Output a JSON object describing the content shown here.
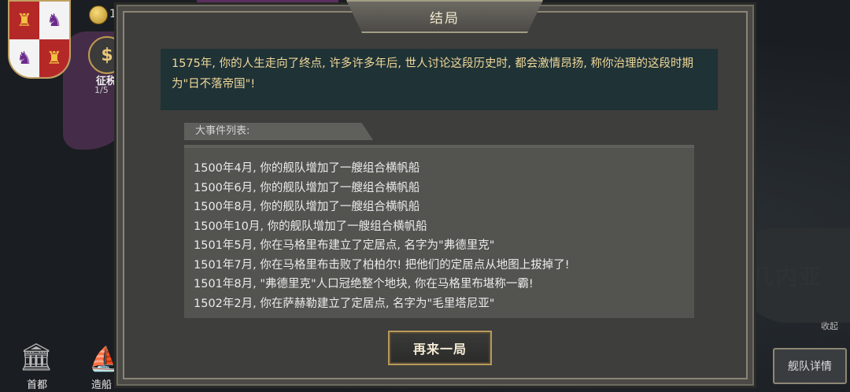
{
  "hud": {
    "coins": "1",
    "conscript_label": "征税",
    "conscript_count": "1/5"
  },
  "bottom_nav": {
    "capital": "首都",
    "shipyard": "造船"
  },
  "map": {
    "place_name": "几内亚",
    "collapse": "收起",
    "fleet_details": "舰队详情"
  },
  "dialog": {
    "title": "结局",
    "summary": "1575年, 你的人生走向了终点, 许多许多年后, 世人讨论这段历史时, 都会激情昂扬, 称你治理的这段时期为\"日不落帝国\"!",
    "events_label": "大事件列表:",
    "events": [
      "1500年4月, 你的舰队增加了一艘组合横帆船",
      "1500年6月, 你的舰队增加了一艘组合横帆船",
      "1500年8月, 你的舰队增加了一艘组合横帆船",
      "1500年10月, 你的舰队增加了一艘组合横帆船",
      "1501年5月, 你在马格里布建立了定居点, 名字为\"弗德里克\"",
      "1501年7月, 你在马格里布击败了柏柏尔! 把他们的定居点从地图上拔掉了!",
      "1501年8月, \"弗德里克\"人口冠绝整个地块, 你在马格里布堪称一霸!",
      "1502年2月, 你在萨赫勒建立了定居点, 名字为\"毛里塔尼亚\""
    ],
    "restart_label": "再来一局"
  }
}
